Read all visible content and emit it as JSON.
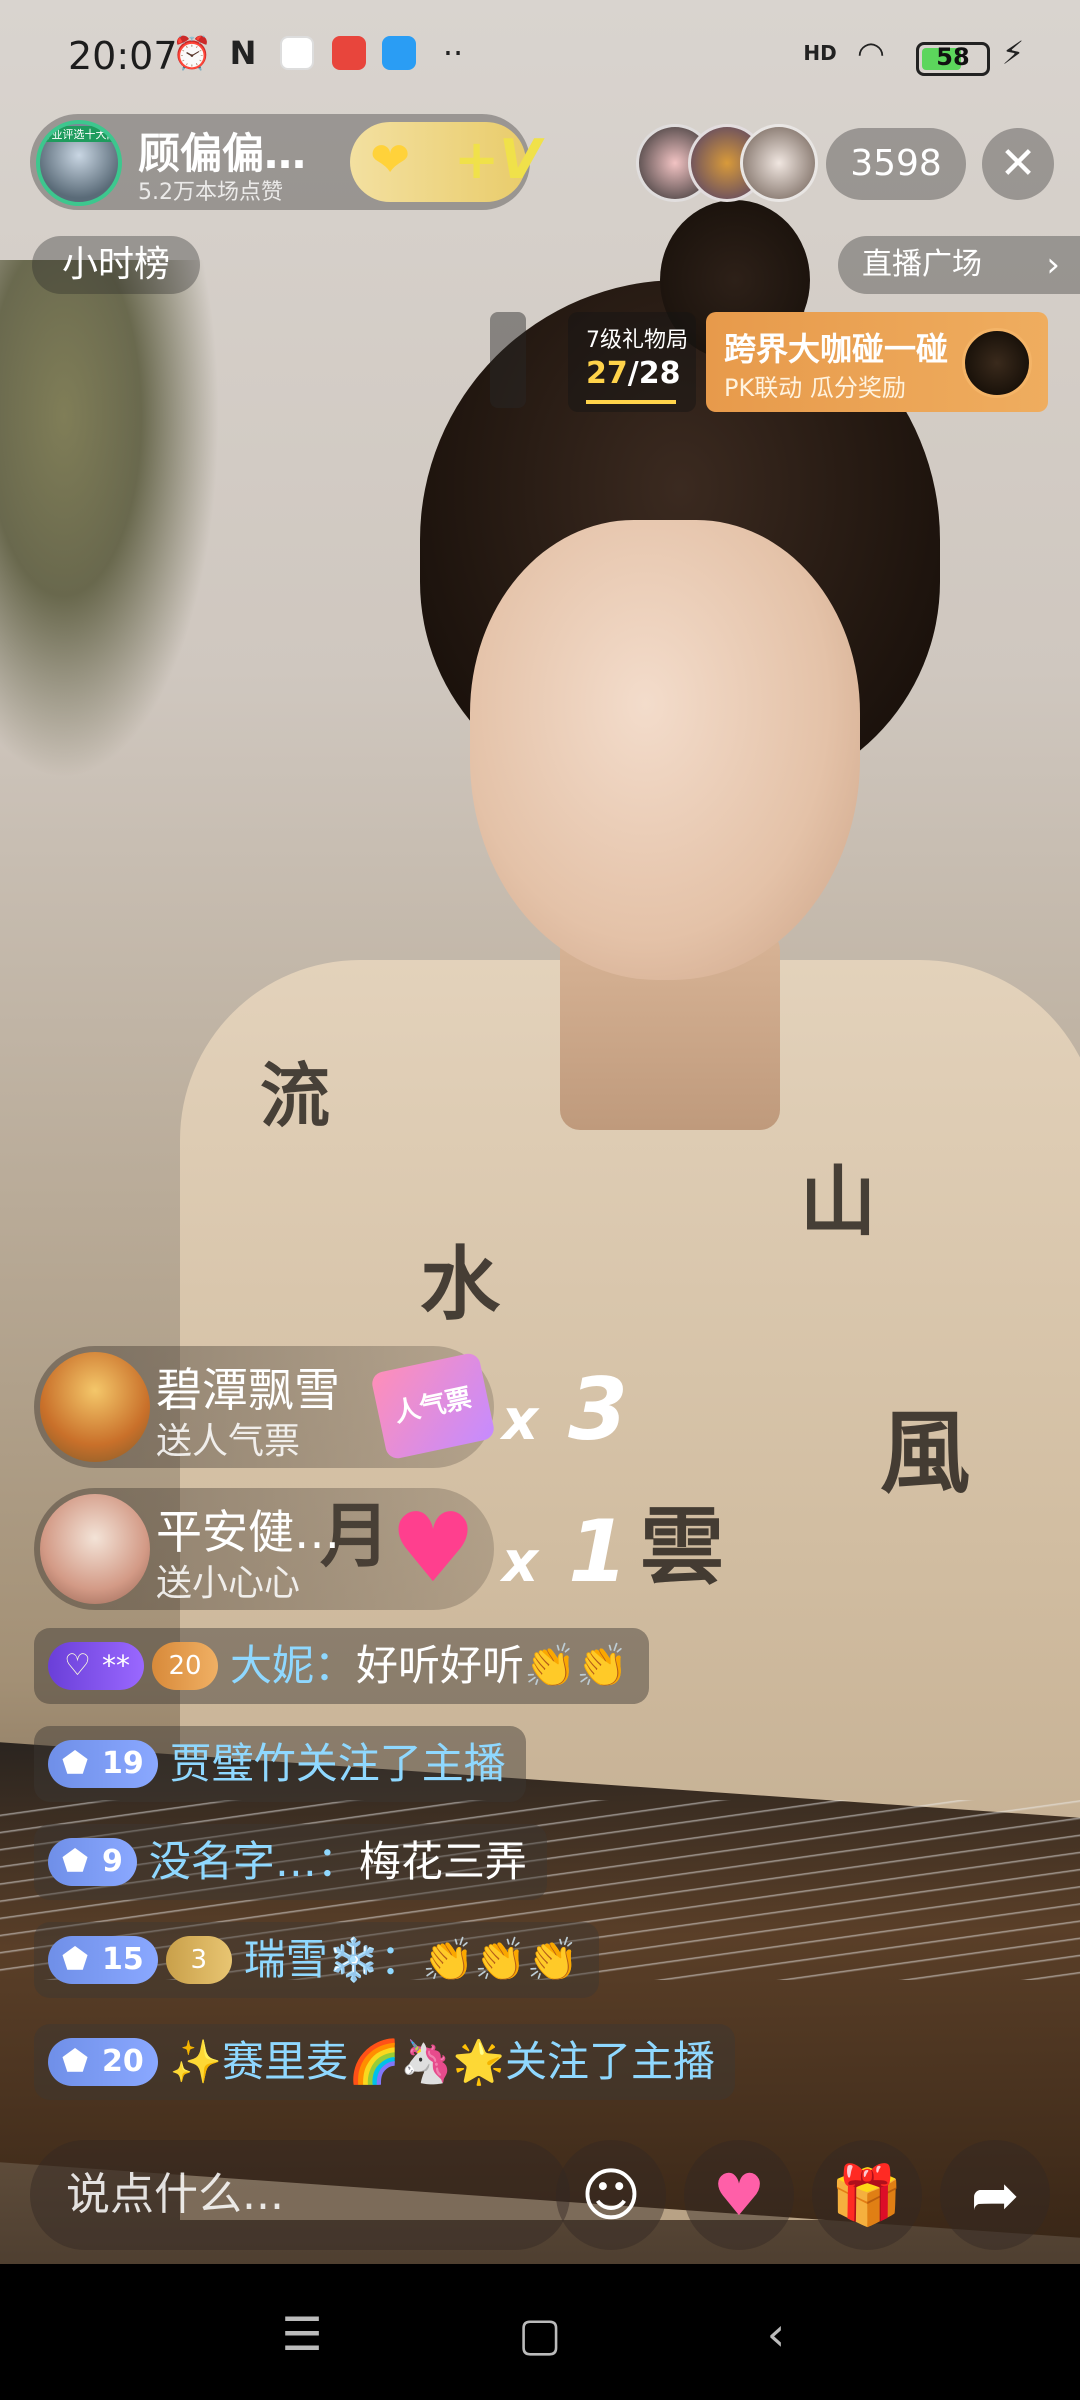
{
  "status_bar": {
    "time": "20:07",
    "icons": [
      "alarm-icon",
      "nfc-icon",
      "play-store-icon",
      "app-red-icon",
      "app-blue-icon",
      "more-dots-icon",
      "signal-hd-icon",
      "wifi-icon",
      "charging-icon"
    ],
    "more_dots": "··",
    "signal_label": "HD",
    "battery_percent": "58"
  },
  "host": {
    "badge_text": "专业评选十大网",
    "name": "顾偏偏…",
    "likes": "5.2万本场点赞"
  },
  "viewer_count": "3598",
  "rank_chip": "小时榜",
  "plaza_link": "直播广场",
  "gift_progress": {
    "label": "7级礼物局",
    "current": "27",
    "total": "/28"
  },
  "pk_banner": {
    "title": "跨界大咖碰一碰",
    "subtitle": "PK联动 瓜分奖励"
  },
  "gift_notifications": [
    {
      "name": "碧潭飘雪",
      "action": "送人气票",
      "gift_label": "人气票",
      "count_prefix": "x",
      "count": "3"
    },
    {
      "name": "平安健…",
      "action": "送小心心",
      "gift_label": "",
      "count_prefix": "x",
      "count": "1"
    }
  ],
  "chat": [
    {
      "fan_badge": "**",
      "club_level": "20",
      "user": "大妮：",
      "message": "好听好听👏👏"
    },
    {
      "level": "19",
      "user": "贾璧竹",
      "message": " 关注了主播"
    },
    {
      "level": "9",
      "user": "没名字…：",
      "message": "梅花三弄"
    },
    {
      "level": "15",
      "club_level": "3",
      "user": "瑞雪❄️：",
      "message": "👏👏👏"
    },
    {
      "level": "20",
      "user": "✨赛里麦🌈🦄🌟",
      "message": " 关注了主播"
    }
  ],
  "input": {
    "placeholder": "说点什么..."
  },
  "bottom_buttons": [
    "emoji-icon",
    "heart-like-icon",
    "gift-icon",
    "share-icon"
  ],
  "colors": {
    "accent_gold": "#ffd34a",
    "level_blue": "#7f9cf5",
    "chat_name": "#8fd8ff",
    "pk_orange": "#ec9f4f"
  }
}
